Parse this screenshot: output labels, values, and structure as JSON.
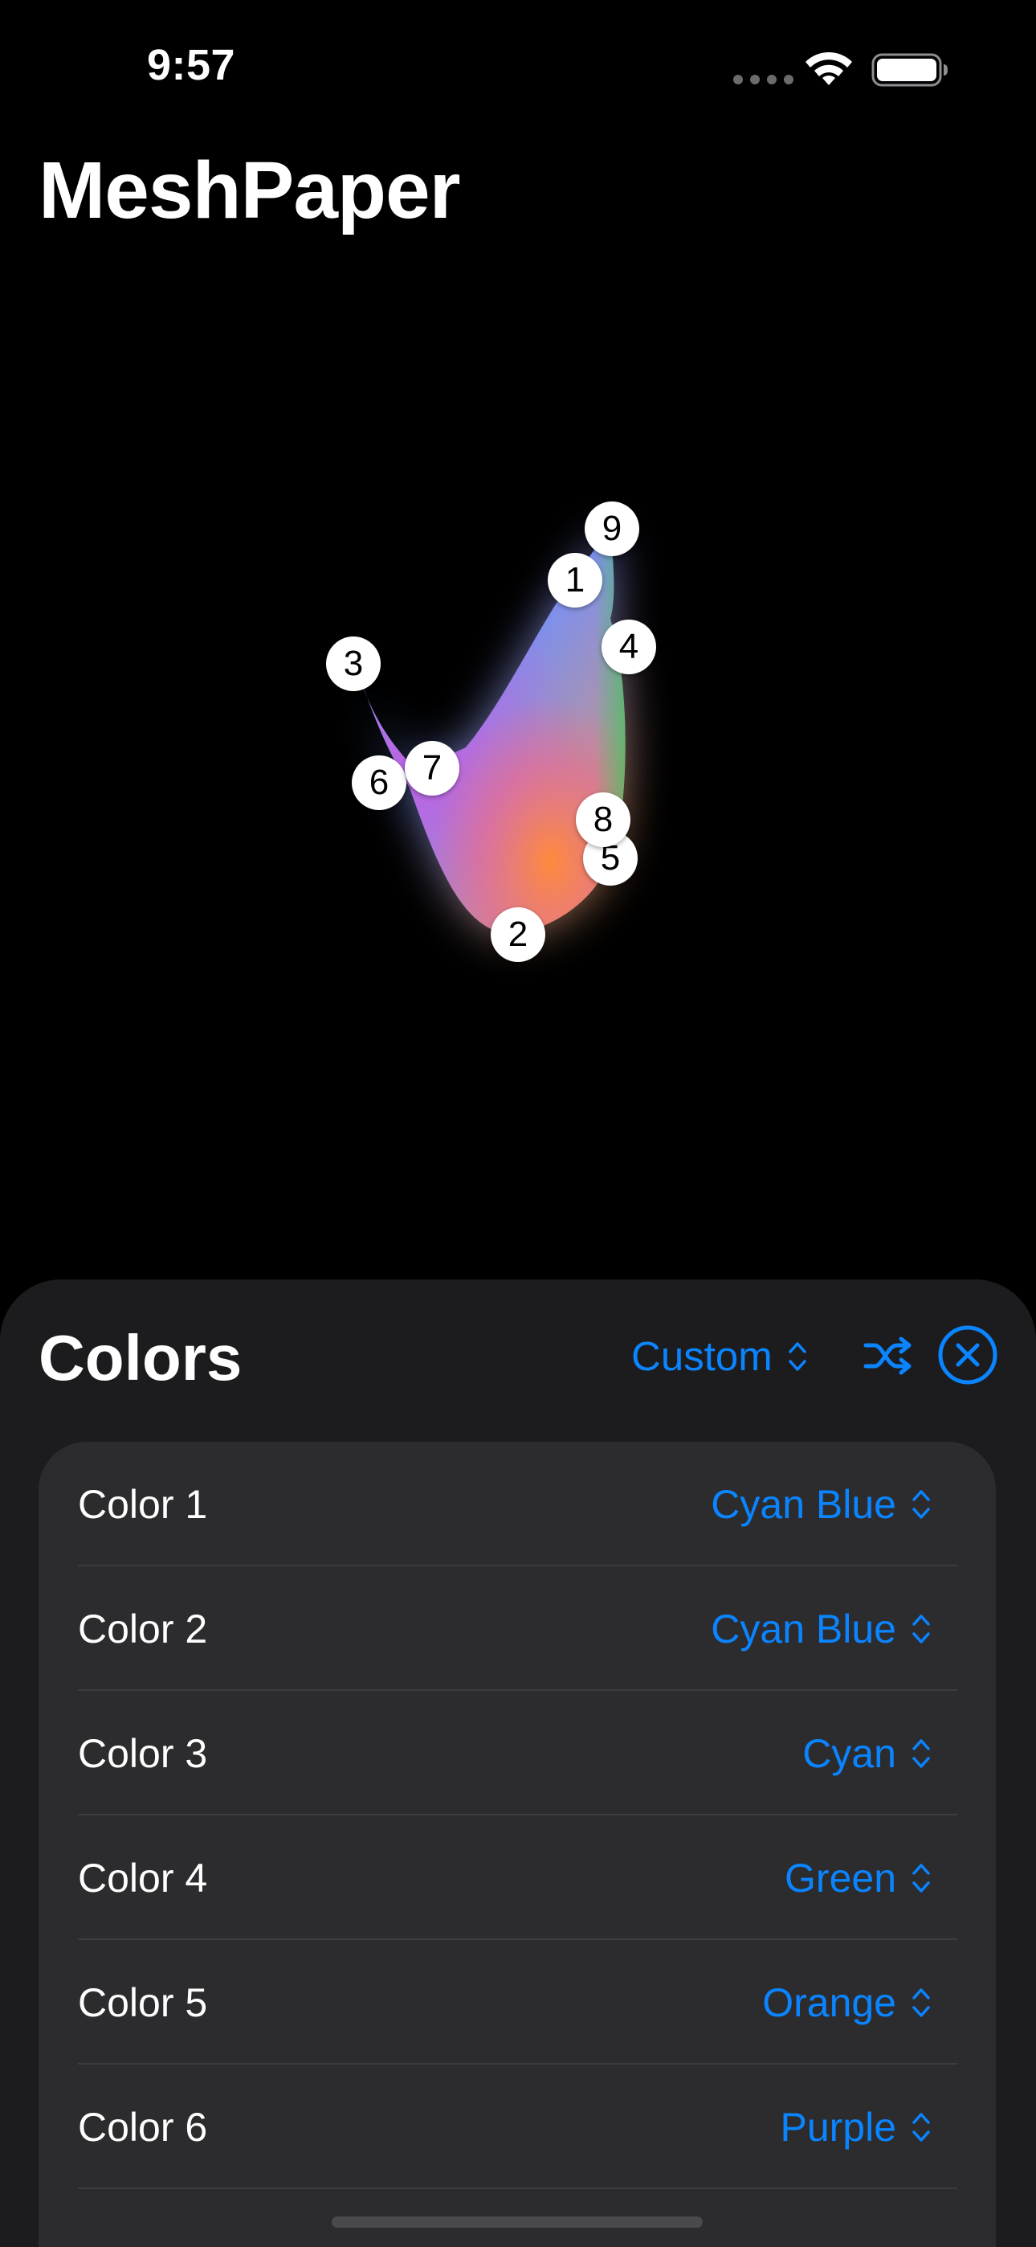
{
  "status_bar": {
    "time": "9:57"
  },
  "app": {
    "title": "MeshPaper"
  },
  "mesh": {
    "handles": [
      "1",
      "2",
      "3",
      "4",
      "5",
      "6",
      "7",
      "8",
      "9"
    ],
    "gradient_colors": {
      "cyan": "#4fd1e8",
      "blue": "#5b8cf0",
      "purple": "#c85ce0",
      "pink": "#e86aa0",
      "orange": "#ff9a3c",
      "green": "#34c759"
    }
  },
  "sheet": {
    "title": "Colors",
    "preset_label": "Custom",
    "shuffle_icon": "shuffle-icon",
    "close_icon": "close-circle-icon",
    "rows": [
      {
        "label": "Color 1",
        "value": "Cyan Blue"
      },
      {
        "label": "Color 2",
        "value": "Cyan Blue"
      },
      {
        "label": "Color 3",
        "value": "Cyan"
      },
      {
        "label": "Color 4",
        "value": "Green"
      },
      {
        "label": "Color 5",
        "value": "Orange"
      },
      {
        "label": "Color 6",
        "value": "Purple"
      }
    ]
  },
  "theme": {
    "accent": "#0a84ff",
    "sheet_background": "#1c1c1e",
    "list_background": "#2c2c2e"
  }
}
